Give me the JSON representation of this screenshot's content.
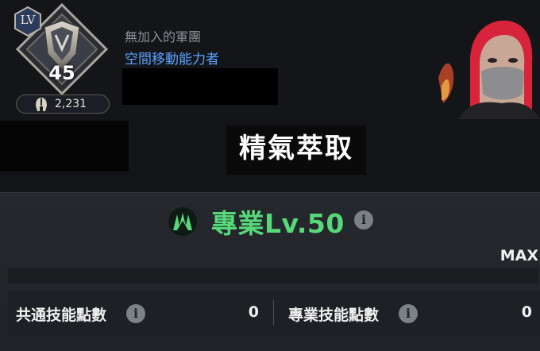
{
  "player": {
    "lv_badge": "LV",
    "level": "45",
    "combat_power": "2,231",
    "legion_status": "無加入的軍團",
    "title": "空間移動能力者"
  },
  "page": {
    "title": "精氣萃取"
  },
  "profession": {
    "level_label": "專業Lv.50",
    "progress_label": "MAX",
    "progress_fraction": 1.0
  },
  "skill_points": {
    "common_label": "共通技能點數",
    "common_value": "0",
    "pro_label": "專業技能點數",
    "pro_value": "0"
  },
  "icons": {
    "info": "i",
    "info_icon": "info-icon",
    "profession_icon": "profession-emblem-icon",
    "power_icon": "helmet-icon"
  },
  "colors": {
    "accent_green": "#57d879",
    "accent_blue": "#5aa2ff",
    "background": "#16181c"
  }
}
